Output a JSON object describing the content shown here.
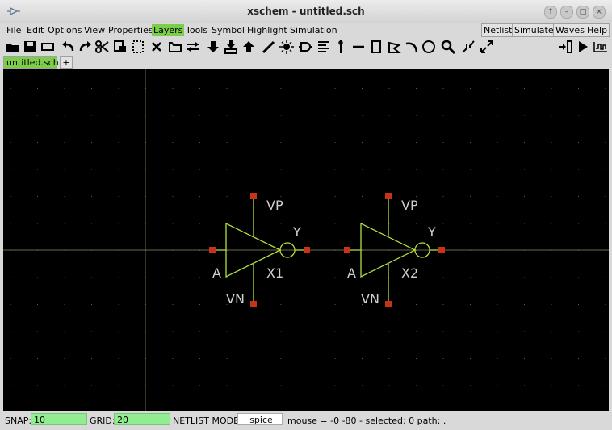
{
  "window": {
    "title": "xschem - untitled.sch",
    "buttons": [
      "↑",
      "–",
      "□",
      "×"
    ]
  },
  "menubar": {
    "left": [
      "File",
      "Edit",
      "Options",
      "View",
      "Properties",
      "Layers",
      "Tools",
      "Symbol",
      "Highlight",
      "Simulation"
    ],
    "active": "Layers",
    "right": [
      "Netlist",
      "Simulate",
      "Waves",
      "Help"
    ]
  },
  "toolbar": {
    "icons": [
      "open-icon",
      "save-icon",
      "reload-icon",
      "undo-icon",
      "redo-icon",
      "cut-icon",
      "copy-icon",
      "paste-icon",
      "delete-icon",
      "move-icon",
      "swap-icon",
      "descend-icon",
      "netlist-push-icon",
      "ascend-icon",
      "wire-icon",
      "light-icon",
      "bus-icon",
      "text-icon",
      "pin-icon",
      "line-icon",
      "rect-icon",
      "polygon-icon",
      "arc-icon",
      "circle-icon",
      "zoom-icon",
      "zoom-out-icon",
      "zoom-full-icon",
      "netlist-icon",
      "simulate-icon",
      "waves-icon"
    ]
  },
  "tabs": {
    "items": [
      "untitled.sch"
    ],
    "add": "+"
  },
  "schematic": {
    "instances": [
      {
        "name": "X1",
        "in": "A",
        "out": "Y",
        "vp": "VP",
        "vn": "VN"
      },
      {
        "name": "X2",
        "in": "A",
        "out": "Y",
        "vp": "VP",
        "vn": "VN"
      }
    ],
    "colors": {
      "background": "#000000",
      "symbol": "#b0e040",
      "pin": "#c83218",
      "text": "#d0d0d0",
      "grid": "#5a5a5a",
      "axis": "#6a6a4a"
    }
  },
  "status": {
    "snap_label": "SNAP:",
    "snap_value": "10",
    "grid_label": "GRID:",
    "grid_value": "20",
    "mode_label": "NETLIST MODE:",
    "mode_value": "spice",
    "info": "mouse = -0 -80 - selected: 0 path: ."
  }
}
